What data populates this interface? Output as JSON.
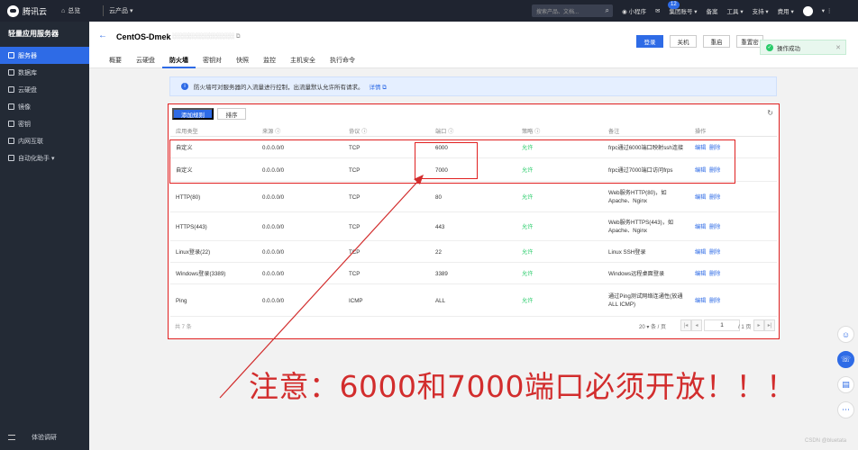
{
  "topbar": {
    "brand": "腾讯云",
    "home": "总览",
    "products": "云产品 ▾",
    "search_placeholder": "搜索产品、文档...",
    "mini_program": "小程序",
    "mail_badge": "12",
    "account": "集团账号 ▾",
    "billing": "备案",
    "tools": "工具 ▾",
    "support": "支持 ▾",
    "fees": "费用 ▾"
  },
  "sidebar": {
    "title": "轻量应用服务器",
    "items": [
      {
        "label": "服务器",
        "active": true
      },
      {
        "label": "数据库",
        "active": false
      },
      {
        "label": "云硬盘",
        "active": false
      },
      {
        "label": "镜像",
        "active": false
      },
      {
        "label": "密钥",
        "active": false
      },
      {
        "label": "内网互联",
        "active": false
      },
      {
        "label": "自动化助手 ▾",
        "active": false
      }
    ],
    "footer": "体验调研"
  },
  "header": {
    "back": "←",
    "instance_name": "CentOS-Dmek",
    "buttons": {
      "login": "登录",
      "shutdown": "关机",
      "restart": "重启",
      "reset": "重置密"
    },
    "tabs": [
      {
        "label": "概要",
        "active": false
      },
      {
        "label": "云硬盘",
        "active": false
      },
      {
        "label": "防火墙",
        "active": true
      },
      {
        "label": "密钥对",
        "active": false
      },
      {
        "label": "快照",
        "active": false
      },
      {
        "label": "监控",
        "active": false
      },
      {
        "label": "主机安全",
        "active": false
      },
      {
        "label": "执行命令",
        "active": false
      }
    ]
  },
  "toast": {
    "text": "操作成功"
  },
  "notice": {
    "text": "防火墙可对服务器的入流量进行控制，出流量默认允许所有请求。",
    "link": "详情 ⧉"
  },
  "firewall": {
    "add_button": "添加规则",
    "sort_button": "排序",
    "columns": [
      "应用类型",
      "来源 ⓘ",
      "协议 ⓘ",
      "端口 ⓘ",
      "策略 ⓘ",
      "备注",
      "操作"
    ],
    "rows": [
      {
        "app": "自定义",
        "source": "0.0.0.0/0",
        "protocol": "TCP",
        "port": "6000",
        "policy": "允许",
        "remark": "frpc通过6000端口映射ssh连接",
        "remark2": "",
        "edit": "编辑",
        "delete": "删除"
      },
      {
        "app": "自定义",
        "source": "0.0.0.0/0",
        "protocol": "TCP",
        "port": "7000",
        "policy": "允许",
        "remark": "frpc通过7000端口访问frps",
        "remark2": "",
        "edit": "编辑",
        "delete": "删除"
      },
      {
        "app": "HTTP(80)",
        "source": "0.0.0.0/0",
        "protocol": "TCP",
        "port": "80",
        "policy": "允许",
        "remark": "Web服务HTTP(80)，如",
        "remark2": "Apache、Nginx",
        "edit": "编辑",
        "delete": "删除"
      },
      {
        "app": "HTTPS(443)",
        "source": "0.0.0.0/0",
        "protocol": "TCP",
        "port": "443",
        "policy": "允许",
        "remark": "Web服务HTTPS(443)，如",
        "remark2": "Apache、Nginx",
        "edit": "编辑",
        "delete": "删除"
      },
      {
        "app": "Linux登录(22)",
        "source": "0.0.0.0/0",
        "protocol": "TCP",
        "port": "22",
        "policy": "允许",
        "remark": "Linux SSH登录",
        "remark2": "",
        "edit": "编辑",
        "delete": "删除"
      },
      {
        "app": "Windows登录(3389)",
        "source": "0.0.0.0/0",
        "protocol": "TCP",
        "port": "3389",
        "policy": "允许",
        "remark": "Windows远程桌面登录",
        "remark2": "",
        "edit": "编辑",
        "delete": "删除"
      },
      {
        "app": "Ping",
        "source": "0.0.0.0/0",
        "protocol": "ICMP",
        "port": "ALL",
        "policy": "允许",
        "remark": "通过Ping测试网络连通性(放通",
        "remark2": "ALL ICMP)",
        "edit": "编辑",
        "delete": "删除"
      }
    ],
    "pager": {
      "total": "共 7 条",
      "page_size": "20 ▾ 条 / 页",
      "first": "|◂",
      "prev": "◂",
      "page": "1",
      "of": "/ 1 页",
      "next": "▸",
      "last": "▸|"
    }
  },
  "annotation": "注意：6000和7000端口必须开放！！！",
  "watermark": "CSDN @bluetata",
  "colors": {
    "accent": "#2e6be6",
    "allow": "#29cc6a",
    "annotation": "#d22d2d",
    "sidebar": "#232a35",
    "topbar": "#1f2430"
  }
}
